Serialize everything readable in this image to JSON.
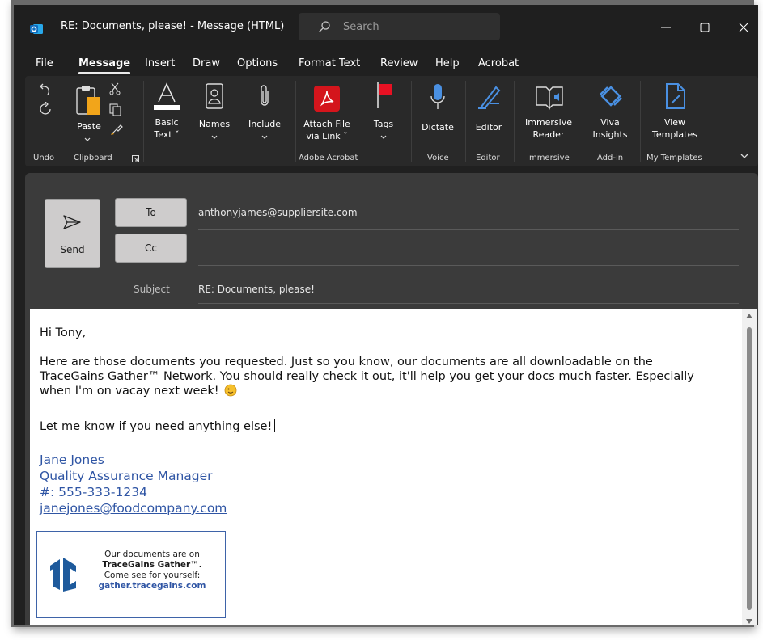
{
  "window": {
    "title": "RE: Documents, please!  -  Message (HTML)",
    "search_placeholder": "Search"
  },
  "menu_tabs": [
    "File",
    "Message",
    "Insert",
    "Draw",
    "Options",
    "Format Text",
    "Review",
    "Help",
    "Acrobat"
  ],
  "ribbon": {
    "paste": "Paste",
    "basic_text_1": "Basic",
    "basic_text_2": "Text ˇ",
    "names": "Names",
    "include": "Include",
    "attach_1": "Attach File",
    "attach_2": "via Link ˇ",
    "tags": "Tags",
    "dictate": "Dictate",
    "editor": "Editor",
    "immersive_1": "Immersive",
    "immersive_2": "Reader",
    "viva_1": "Viva",
    "viva_2": "Insights",
    "templates_1": "View",
    "templates_2": "Templates",
    "groups": {
      "undo": "Undo",
      "clipboard": "Clipboard",
      "adobe": "Adobe Acrobat",
      "voice": "Voice",
      "editor": "Editor",
      "immersive": "Immersive",
      "addin": "Add-in",
      "my_templates": "My Templates"
    }
  },
  "compose": {
    "send": "Send",
    "to": "To",
    "cc": "Cc",
    "to_value": "anthonyjames@suppliersite.com",
    "subject_label": "Subject",
    "subject_value": "RE: Documents, please!"
  },
  "body": {
    "greeting": "Hi Tony,",
    "para1_line1": "Here are those documents you requested. Just so you know, our documents are all downloadable on the",
    "para1_line2": "TraceGains Gather™ Network. You should really check it out, it'll help you get your docs much faster. Especially",
    "para1_line3": "when I'm on vacay next week!",
    "para2": "Let me know if you need anything else!",
    "sig_name": "Jane Jones",
    "sig_title": "Quality Assurance Manager",
    "sig_phone": "#: 555-333-1234",
    "sig_email": "janejones@foodcompany.com",
    "banner_line1": "Our documents are on",
    "banner_line2": "TraceGains Gather™.",
    "banner_line3": "Come see for yourself:",
    "banner_line4": "gather.tracegains.com"
  },
  "colors": {
    "signature": "#2f55a4",
    "acrobat": "#d4151c",
    "accent_blue": "#4a90e2"
  }
}
